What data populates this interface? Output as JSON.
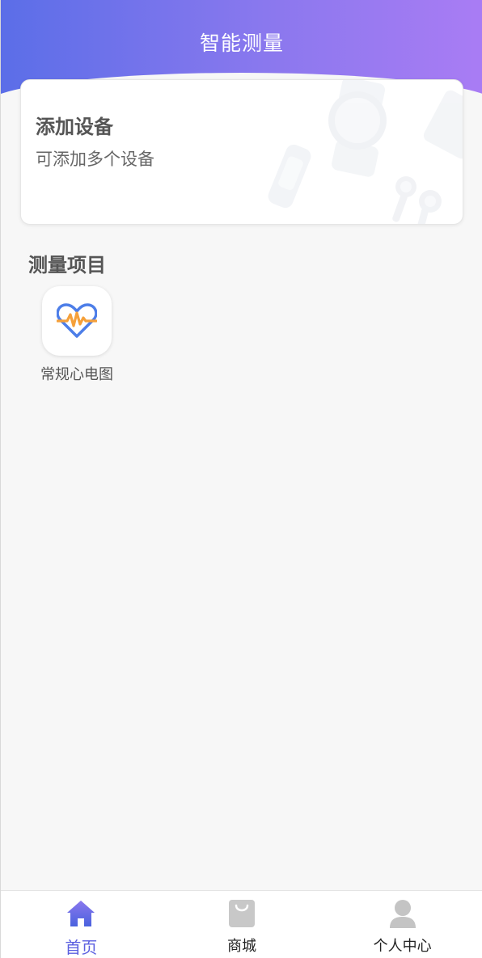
{
  "header": {
    "title": "智能测量"
  },
  "device_card": {
    "title": "添加设备",
    "subtitle": "可添加多个设备"
  },
  "measure_section": {
    "title": "测量项目",
    "items": [
      {
        "label": "常规心电图",
        "icon": "heart-ecg-icon"
      }
    ]
  },
  "tabbar": {
    "items": [
      {
        "label": "首页",
        "icon": "home-icon",
        "active": true
      },
      {
        "label": "商城",
        "icon": "shopping-bag-icon",
        "active": false
      },
      {
        "label": "个人中心",
        "icon": "user-icon",
        "active": false
      }
    ]
  },
  "colors": {
    "header_gradient_start": "#5b6ee8",
    "header_gradient_end": "#a97cf4",
    "active_tab": "#5b5fe0",
    "ecg_orange": "#f5a03a",
    "heart_blue": "#4d7ee8"
  }
}
